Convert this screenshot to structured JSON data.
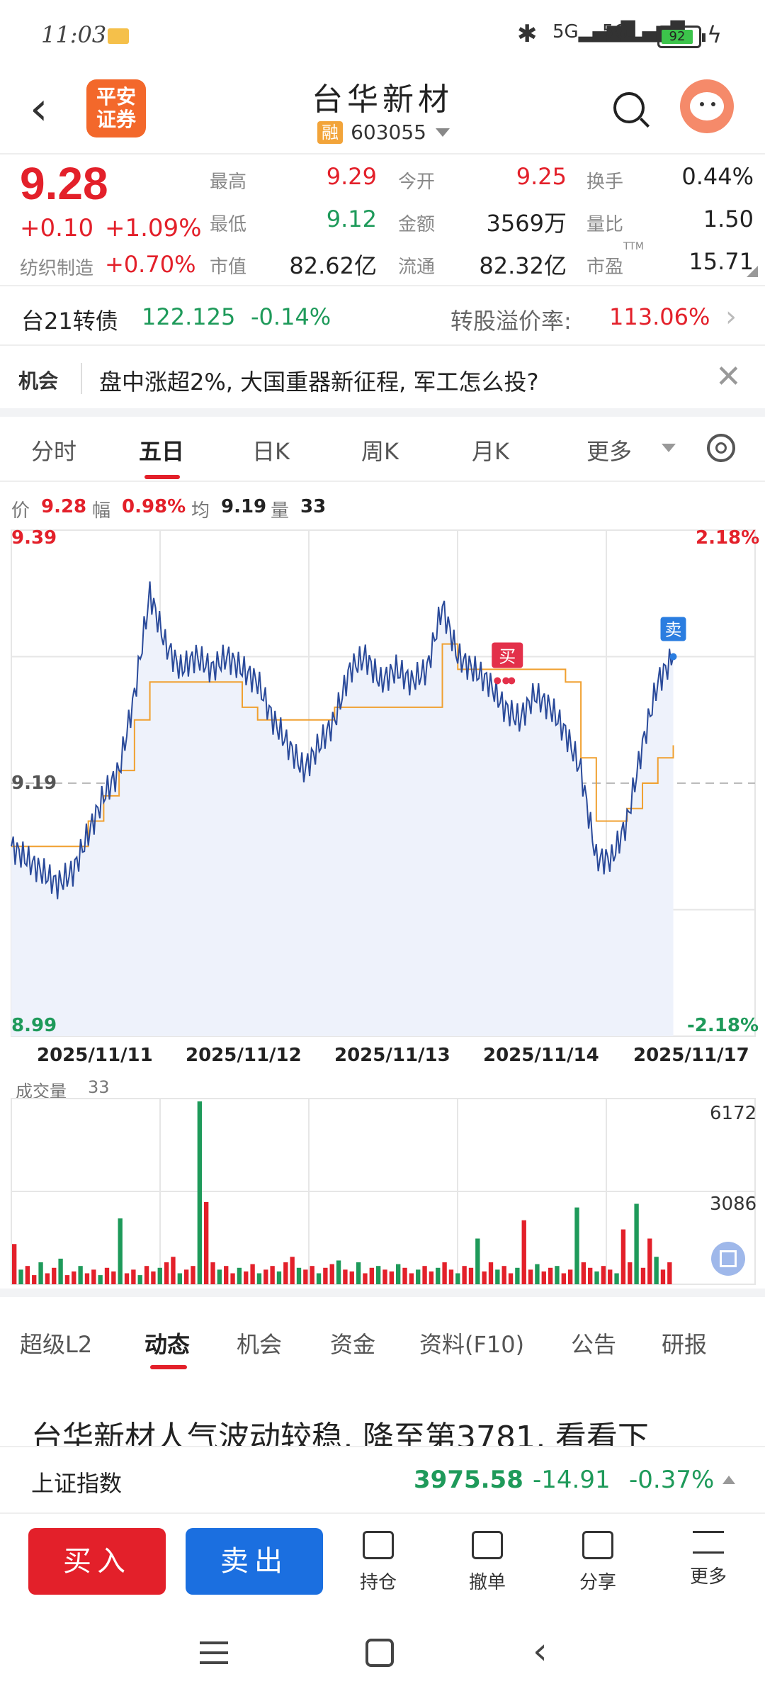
{
  "status": {
    "time": "11:03",
    "battery": "92",
    "signal1": "5G",
    "signal2": "5G"
  },
  "header": {
    "logo_line1": "平安",
    "logo_line2": "证券",
    "title": "台华新材",
    "tag": "融",
    "code": "603055"
  },
  "quote": {
    "price": "9.28",
    "change": "+0.10",
    "change_pct": "+1.09%",
    "fz_label": "纺织制造",
    "fz_value": "+0.70%",
    "high_label": "最高",
    "high": "9.29",
    "low_label": "最低",
    "low": "9.12",
    "mv_label": "市值",
    "mv": "82.62亿",
    "open_label": "今开",
    "open": "9.25",
    "amount_label": "金额",
    "amount": "3569万",
    "float_label": "流通",
    "float": "82.32亿",
    "turnover_label": "换手",
    "turnover": "0.44%",
    "vr_label": "量比",
    "vr": "1.50",
    "pe_label": "市盈",
    "pe_sup": "TTM",
    "pe": "15.71"
  },
  "cb": {
    "name": "台21转债",
    "price": "122.125",
    "pct": "-0.14%",
    "premium_label": "转股溢价率:",
    "premium": "113.06%"
  },
  "opp": {
    "tag": "机会",
    "text": "盘中涨超2%, 大国重器新征程, 军工怎么投?"
  },
  "tabs": [
    "分时",
    "五日",
    "日K",
    "周K",
    "月K",
    "更多"
  ],
  "active_tab": "五日",
  "indicator": {
    "p_label": "价",
    "p": "9.28",
    "f_label": "幅",
    "f": "0.98%",
    "a_label": "均",
    "a": "9.19",
    "v_label": "量",
    "v": "33"
  },
  "chart_data": {
    "type": "line",
    "x_labels": [
      "2025/11/11",
      "2025/11/12",
      "2025/11/13",
      "2025/11/14",
      "2025/11/17"
    ],
    "ylim": [
      8.99,
      9.39
    ],
    "y_top_label": "9.39",
    "y_mid_label": "9.19",
    "y_bottom_label": "8.99",
    "pct_top": "2.18%",
    "pct_bottom": "-2.18%",
    "series": [
      {
        "values": [
          9.14,
          9.13,
          9.12,
          9.11,
          9.12,
          9.15,
          9.18,
          9.2,
          9.26,
          9.34,
          9.3,
          9.28,
          9.29,
          9.28,
          9.29,
          9.28,
          9.27,
          9.24,
          9.22,
          9.2,
          9.22,
          9.24,
          9.28,
          9.29,
          9.27,
          9.28,
          9.27,
          9.28,
          9.33,
          9.29,
          9.28,
          9.27,
          9.25,
          9.24,
          9.26,
          9.25,
          9.23,
          9.2,
          9.13,
          9.13,
          9.16,
          9.22,
          9.27,
          9.29
        ]
      },
      {
        "values": [
          9.14,
          9.14,
          9.14,
          9.14,
          9.14,
          9.16,
          9.18,
          9.2,
          9.24,
          9.27,
          9.27,
          9.27,
          9.27,
          9.27,
          9.27,
          9.25,
          9.24,
          9.24,
          9.24,
          9.24,
          9.24,
          9.25,
          9.25,
          9.25,
          9.25,
          9.25,
          9.25,
          9.25,
          9.3,
          9.28,
          9.28,
          9.28,
          9.28,
          9.28,
          9.28,
          9.28,
          9.27,
          9.21,
          9.16,
          9.16,
          9.17,
          9.19,
          9.21,
          9.22
        ]
      }
    ],
    "buy_label": "买",
    "sell_label": "卖"
  },
  "volume": {
    "label": "成交量",
    "value": "33",
    "max": "6172",
    "mid": "3086",
    "bars": [
      0.22,
      0.08,
      0.1,
      0.05,
      0.12,
      0.06,
      0.09,
      0.14,
      0.05,
      0.07,
      0.1,
      0.06,
      0.08,
      0.05,
      0.09,
      0.07,
      0.36,
      0.06,
      0.08,
      0.05,
      0.1,
      0.07,
      0.09,
      0.12,
      0.15,
      0.06,
      0.08,
      0.1,
      1.0,
      0.45,
      0.12,
      0.08,
      0.1,
      0.06,
      0.09,
      0.07,
      0.11,
      0.06,
      0.08,
      0.1,
      0.07,
      0.12,
      0.15,
      0.09,
      0.08,
      0.1,
      0.06,
      0.09,
      0.11,
      0.13,
      0.08,
      0.07,
      0.12,
      0.06,
      0.09,
      0.1,
      0.08,
      0.07,
      0.11,
      0.09,
      0.06,
      0.08,
      0.1,
      0.07,
      0.09,
      0.12,
      0.08,
      0.06,
      0.1,
      0.09,
      0.25,
      0.07,
      0.12,
      0.08,
      0.1,
      0.06,
      0.09,
      0.35,
      0.08,
      0.11,
      0.07,
      0.09,
      0.1,
      0.06,
      0.08,
      0.42,
      0.12,
      0.09,
      0.07,
      0.1,
      0.08,
      0.06,
      0.3,
      0.12,
      0.44,
      0.09,
      0.25,
      0.15,
      0.08,
      0.12
    ]
  },
  "bottom_tabs": [
    "超级L2",
    "动态",
    "机会",
    "资金",
    "资料(F10)",
    "公告",
    "研报"
  ],
  "active_bottom_tab": "动态",
  "news": "台华新材人气波动较稳, 降至第3781, 看看下",
  "index": {
    "name": "上证指数",
    "value": "3975.58",
    "change": "-14.91",
    "pct": "-0.37%"
  },
  "actions": {
    "buy": "买入",
    "sell": "卖出",
    "hold": "持仓",
    "cancel": "撤单",
    "share": "分享",
    "more": "更多"
  }
}
